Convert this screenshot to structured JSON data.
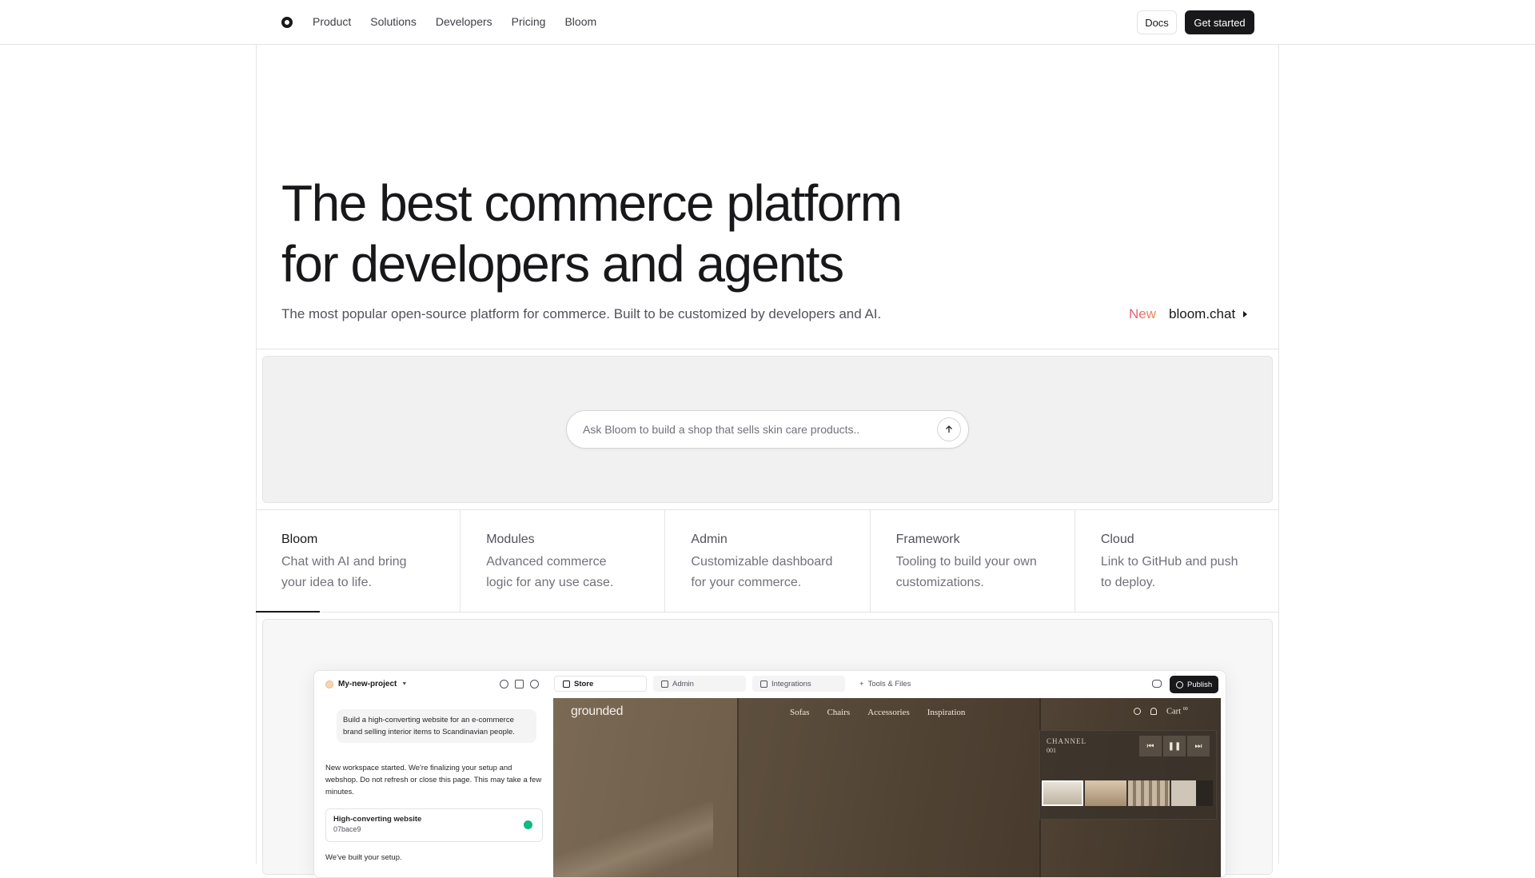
{
  "nav": {
    "links": [
      "Product",
      "Solutions",
      "Developers",
      "Pricing",
      "Bloom"
    ],
    "docs": "Docs",
    "cta": "Get started"
  },
  "hero": {
    "title_line1": "The best commerce platform",
    "title_line2": "for developers and agents",
    "subtitle": "The most popular open-source platform for commerce. Built to be customized by developers and AI.",
    "new_tag": "New",
    "new_link": "bloom.chat"
  },
  "prompt": {
    "placeholder": "Ask Bloom to build a shop that sells skin care products.."
  },
  "tabs": [
    {
      "title": "Bloom",
      "desc_line1": "Chat with AI and bring",
      "desc_line2": "your idea to life.",
      "active": true
    },
    {
      "title": "Modules",
      "desc_line1": "Advanced commerce",
      "desc_line2": "logic for any use case.",
      "active": false
    },
    {
      "title": "Admin",
      "desc_line1": "Customizable dashboard",
      "desc_line2": "for your commerce.",
      "active": false
    },
    {
      "title": "Framework",
      "desc_line1": "Tooling to build your own",
      "desc_line2": "customizations.",
      "active": false
    },
    {
      "title": "Cloud",
      "desc_line1": "Link to GitHub and push",
      "desc_line2": "to deploy.",
      "active": false
    }
  ],
  "app": {
    "project": "My-new-project",
    "user_message": "Build a high-converting website for an e-commerce brand selling interior items to Scandinavian people.",
    "assistant_message": "New workspace started. We're finalizing your setup and webshop. Do not refresh or close this page. This may take a few minutes.",
    "card_title": "High-converting website",
    "card_sub": "07bace9",
    "assistant_message2": "We've built your setup.",
    "tabs": [
      "Store",
      "Admin",
      "Integrations",
      "Tools & Files"
    ],
    "publish": "Publish",
    "store": {
      "brand": "grounded",
      "nav": [
        "Sofas",
        "Chairs",
        "Accessories",
        "Inspiration"
      ],
      "cart": "Cart",
      "cart_count": "00",
      "channel_label": "CHANNEL",
      "channel_num": "001"
    }
  },
  "colors": {
    "accent": "#18181b",
    "new_gradient_start": "#e0567a",
    "new_gradient_end": "#f08a4b",
    "success": "#10b981"
  }
}
